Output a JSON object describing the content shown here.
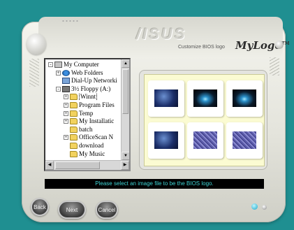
{
  "app": {
    "brand": "/ISUS",
    "caption": "Customize BIOS logo",
    "title": "MyLogo",
    "trademark": "TM"
  },
  "tree": {
    "items": [
      {
        "label": "My Computer",
        "icon": "computer-icon",
        "expander": "-",
        "level": 0
      },
      {
        "label": "Web Folders",
        "icon": "web-folders-icon",
        "expander": "+",
        "level": 1
      },
      {
        "label": "Dial-Up Networki",
        "icon": "dialup-icon",
        "expander": "",
        "level": 1
      },
      {
        "label": "3½ Floppy (A:)",
        "icon": "floppy-icon",
        "expander": "-",
        "level": 1
      },
      {
        "label": "Winnt",
        "icon": "folder-icon",
        "expander": "+",
        "level": 2,
        "selected": true
      },
      {
        "label": "Program Files",
        "icon": "folder-icon",
        "expander": "+",
        "level": 2
      },
      {
        "label": "Temp",
        "icon": "folder-icon",
        "expander": "+",
        "level": 2
      },
      {
        "label": "My Installatic",
        "icon": "folder-icon",
        "expander": "+",
        "level": 2
      },
      {
        "label": "batch",
        "icon": "folder-icon",
        "expander": "",
        "level": 2
      },
      {
        "label": "OfficeScan N",
        "icon": "folder-icon",
        "expander": "+",
        "level": 2
      },
      {
        "label": "download",
        "icon": "folder-icon",
        "expander": "",
        "level": 2
      },
      {
        "label": "My Music",
        "icon": "folder-icon",
        "expander": "",
        "level": 2
      }
    ]
  },
  "preview": {
    "thumbnails": [
      {
        "name": "windows-logo-thumbnail",
        "kind": "windows"
      },
      {
        "name": "blue-logo-thumbnail-1",
        "kind": "logo"
      },
      {
        "name": "blue-logo-thumbnail-2",
        "kind": "logo"
      },
      {
        "name": "windows-logo-thumbnail-2",
        "kind": "windows"
      },
      {
        "name": "purple-texture-thumbnail-1",
        "kind": "texture"
      },
      {
        "name": "purple-texture-thumbnail-2",
        "kind": "texture"
      }
    ]
  },
  "status": {
    "message": "Please select an image file to be the BIOS logo."
  },
  "buttons": {
    "back": "Back",
    "next": "Next",
    "cancel": "Cancel"
  },
  "colors": {
    "background": "#1f8f91",
    "status_text": "#3ed2d2",
    "preview_panel": "#fbfbd2"
  }
}
